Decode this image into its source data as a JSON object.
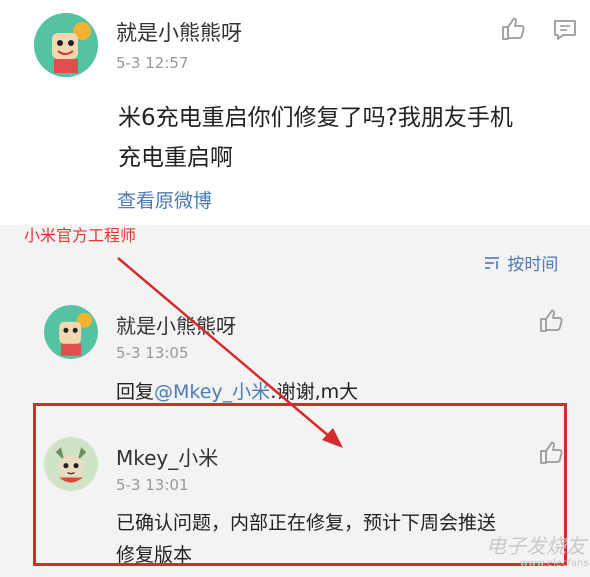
{
  "post": {
    "username": "就是小熊熊呀",
    "timestamp": "5-3 12:57",
    "text_line1": "米6充电重启你们修复了吗?我朋友手机",
    "text_line2": "充电重启啊",
    "view_original": "查看原微博"
  },
  "annotation": {
    "label": "小米官方工程师"
  },
  "comments": {
    "sort_label": "按时间",
    "items": [
      {
        "username": "就是小熊熊呀",
        "timestamp": "5-3 13:05",
        "reply_prefix": "回复",
        "mention": "@Mkey_小米",
        "reply_text": ":谢谢,m大"
      },
      {
        "username": "Mkey_小米",
        "timestamp": "5-3 13:01",
        "text_line1": "已确认问题，内部正在修复，预计下周会推送",
        "text_line2": "修复版本"
      }
    ]
  },
  "watermark": {
    "text": "电子发烧友",
    "url": "www.elecfans.com"
  },
  "colors": {
    "accent_link": "#4c7bb5",
    "annotation_red": "#d42b2b"
  },
  "icons": [
    "thumbs-up-icon",
    "comment-icon",
    "sort-icon"
  ]
}
